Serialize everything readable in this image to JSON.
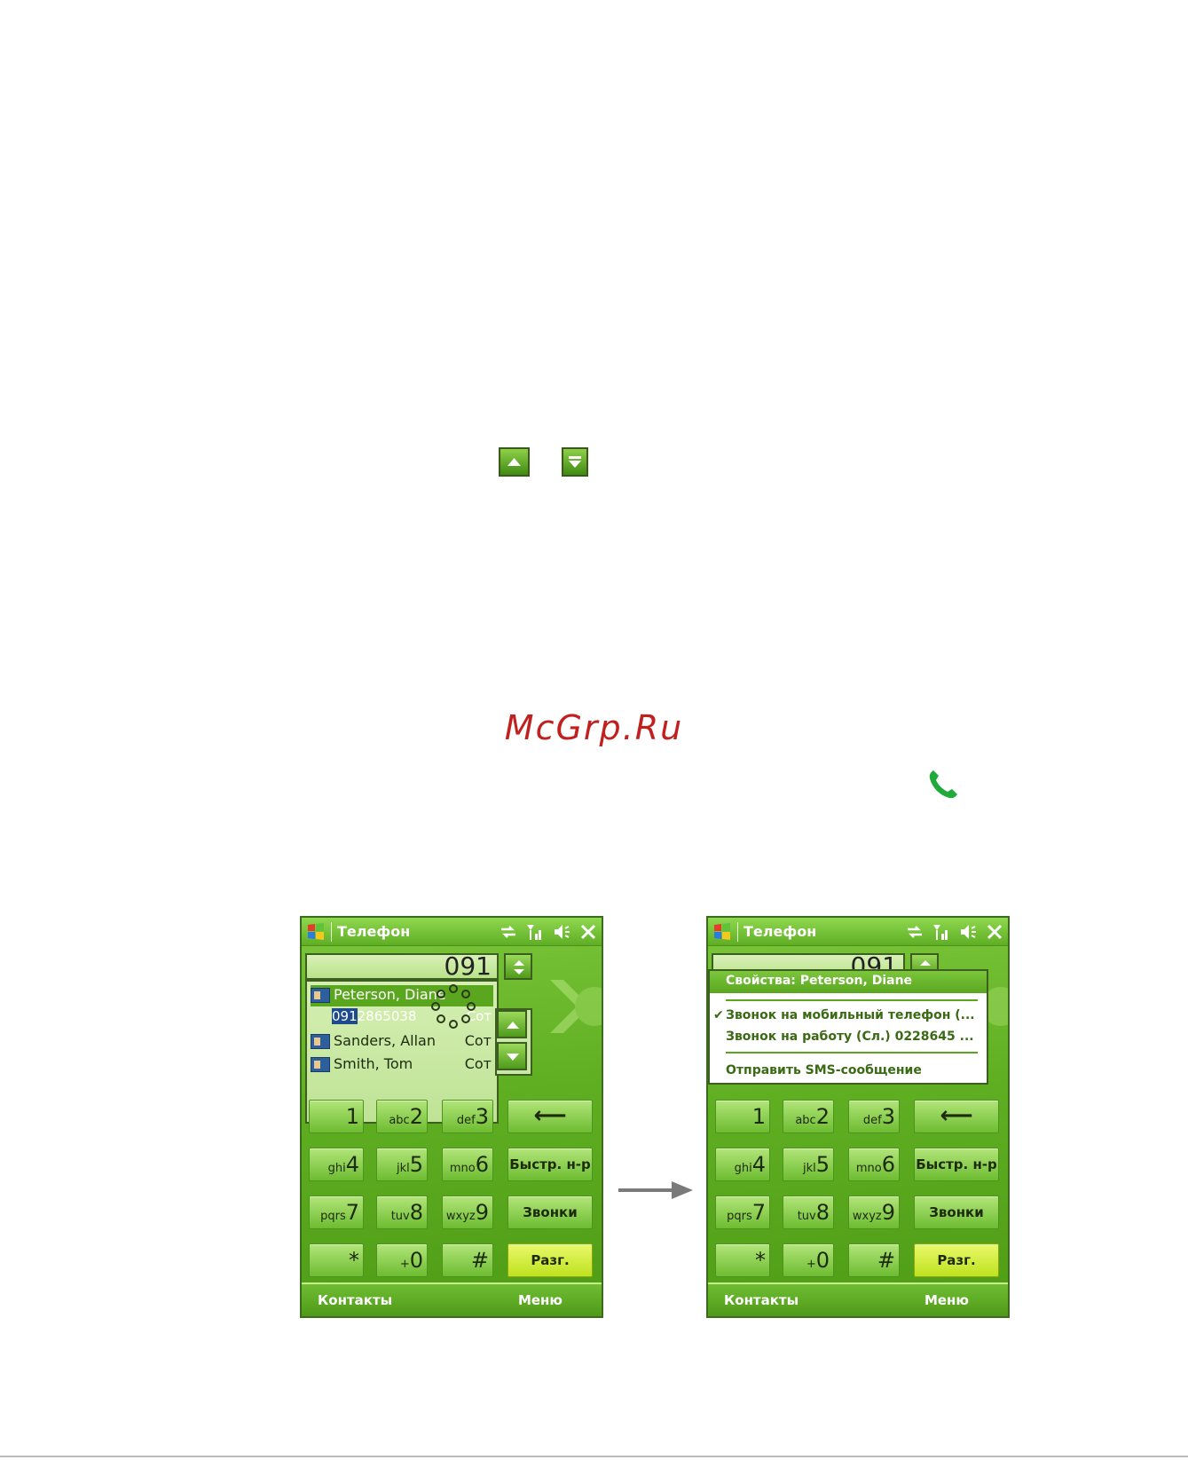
{
  "watermark": "McGrp.Ru",
  "colors": {
    "accent": "#5aa61f",
    "watermark": "#c0201e",
    "talk_key": "#d8f03a"
  },
  "icons": {
    "scroll_up": "triangle-up-icon",
    "scroll_down": "triangle-down-icon",
    "call": "phone-handset-icon",
    "arrow": "right-arrow-icon"
  },
  "screens": {
    "left": {
      "title": "Телефон",
      "number": "091",
      "dropdown": {
        "items": [
          {
            "name": "Peterson, Diane",
            "selected": true,
            "number_highlight": "091",
            "number_rest": "2865038",
            "kind": "Сот"
          },
          {
            "name": "Sanders, Allan",
            "kind": "Сот"
          },
          {
            "name": "Smith, Tom",
            "kind": "Сот"
          }
        ]
      },
      "keypad": {
        "k1": {
          "sub": "",
          "main": "1"
        },
        "k2": {
          "sub": "abc",
          "main": "2"
        },
        "k3": {
          "sub": "def",
          "main": "3"
        },
        "k4": {
          "sub": "ghi",
          "main": "4"
        },
        "k5": {
          "sub": "jkl",
          "main": "5"
        },
        "k6": {
          "sub": "mno",
          "main": "6"
        },
        "k7": {
          "sub": "pqrs",
          "main": "7"
        },
        "k8": {
          "sub": "tuv",
          "main": "8"
        },
        "k9": {
          "sub": "wxyz",
          "main": "9"
        },
        "kstar": {
          "sub": "",
          "main": "*"
        },
        "k0": {
          "sub": "+",
          "main": "0"
        },
        "khash": {
          "sub": "",
          "main": "#"
        },
        "backspace": "⟵",
        "speed": "Быстр. н-р",
        "calls": "Звонки",
        "talk": "Разг."
      },
      "softkeys": {
        "left": "Контакты",
        "right": "Меню"
      }
    },
    "right": {
      "title": "Телефон",
      "number": "091",
      "context_menu": {
        "header": "Свойства: Peterson, Diane",
        "items": [
          {
            "label": "Звонок на мобильный телефон (...",
            "checked": true
          },
          {
            "label": "Звонок на работу (Сл.) 0228645 ...",
            "checked": false
          },
          {
            "label": "Отправить SMS-сообщение",
            "checked": false
          }
        ]
      },
      "keypad": {
        "k1": {
          "sub": "",
          "main": "1"
        },
        "k2": {
          "sub": "abc",
          "main": "2"
        },
        "k3": {
          "sub": "def",
          "main": "3"
        },
        "k4": {
          "sub": "ghi",
          "main": "4"
        },
        "k5": {
          "sub": "jkl",
          "main": "5"
        },
        "k6": {
          "sub": "mno",
          "main": "6"
        },
        "k7": {
          "sub": "pqrs",
          "main": "7"
        },
        "k8": {
          "sub": "tuv",
          "main": "8"
        },
        "k9": {
          "sub": "wxyz",
          "main": "9"
        },
        "kstar": {
          "sub": "",
          "main": "*"
        },
        "k0": {
          "sub": "+",
          "main": "0"
        },
        "khash": {
          "sub": "",
          "main": "#"
        },
        "backspace": "⟵",
        "speed": "Быстр. н-р",
        "calls": "Звонки",
        "talk": "Разг."
      },
      "softkeys": {
        "left": "Контакты",
        "right": "Меню"
      }
    }
  }
}
